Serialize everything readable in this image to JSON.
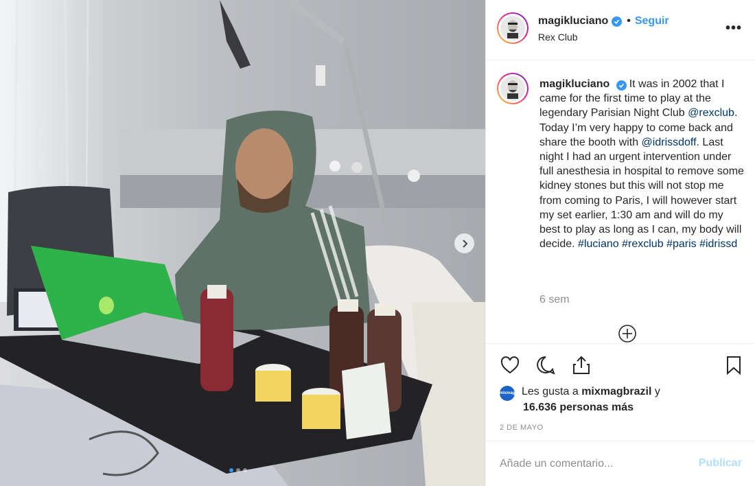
{
  "post": {
    "username": "magikluciano",
    "follow_label": "Seguir",
    "separator": "•",
    "location": "Rex Club",
    "more_label": "•••"
  },
  "caption": {
    "username": "magikluciano",
    "segments": [
      {
        "text": "It was in 2002 that I came for the first time to play at the legendary Parisian Night Club ",
        "link": false
      },
      {
        "text": "@rexclub",
        "link": true
      },
      {
        "text": ". Today I’m very happy to come back and share the booth with ",
        "link": false
      },
      {
        "text": "@idrissdoff",
        "link": true
      },
      {
        "text": ". Last night I had an urgent intervention under full anesthesia in hospital to remove some kidney stones but this will not stop me from coming to Paris, I will however start my set earlier, 1:30 am and will do my best to play as long as I can, my body will decide. ",
        "link": false
      },
      {
        "text": "#luciano",
        "link": true
      },
      {
        "text": " ",
        "link": false
      },
      {
        "text": "#rexclub",
        "link": true
      },
      {
        "text": " ",
        "link": false
      },
      {
        "text": "#paris",
        "link": true
      },
      {
        "text": " ",
        "link": false
      },
      {
        "text": "#idrissd",
        "link": true
      }
    ],
    "time_ago": "6 sem"
  },
  "likes": {
    "prefix": "Les gusta a",
    "first_liker": "mixmagbrazil",
    "joiner": "y",
    "count_text": "16.636 personas más",
    "liker_avatar_text": "mixmag"
  },
  "date": "2 DE MAYO",
  "comment": {
    "placeholder": "Añade un comentario...",
    "publish_label": "Publicar"
  },
  "carousel": {
    "total_slides": 3,
    "current_slide": 1
  },
  "colors": {
    "accent": "#3897f0",
    "link": "#003569",
    "muted": "#8e8e8e",
    "publish_disabled": "#b2dffc"
  },
  "icons": [
    "heart-icon",
    "comment-icon",
    "share-icon",
    "bookmark-icon",
    "verified-icon",
    "add-circle-icon",
    "chevron-right-icon"
  ]
}
